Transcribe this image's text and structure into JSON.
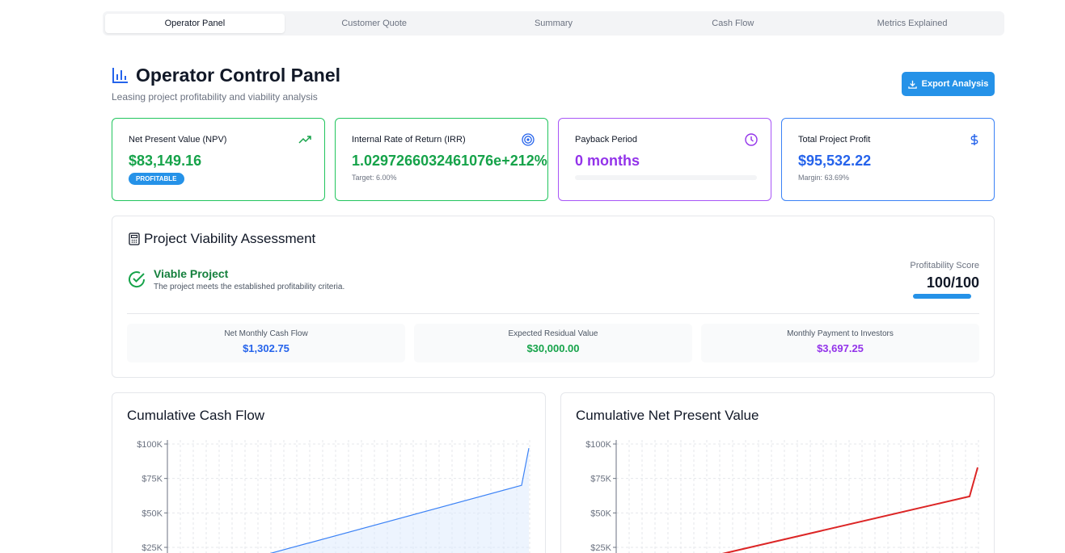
{
  "tabs": [
    "Operator Panel",
    "Customer Quote",
    "Summary",
    "Cash Flow",
    "Metrics Explained"
  ],
  "header": {
    "title": "Operator Control Panel",
    "subtitle": "Leasing project profitability and viability analysis",
    "export_label": "Export Analysis"
  },
  "kpis": {
    "npv": {
      "label": "Net Present Value (NPV)",
      "value": "$83,149.16",
      "badge": "PROFITABLE",
      "color": "#16a34a"
    },
    "irr": {
      "label": "Internal Rate of Return (IRR)",
      "value": "1.0297266032461076e+212%",
      "sub": "Target: 6.00%",
      "color": "#16a34a"
    },
    "payback": {
      "label": "Payback Period",
      "value": "0 months",
      "progress": 0,
      "color": "#9333ea"
    },
    "profit": {
      "label": "Total Project Profit",
      "value": "$95,532.22",
      "sub": "Margin: 63.69%",
      "color": "#2563eb"
    }
  },
  "viability": {
    "title": "Project Viability Assessment",
    "status_title": "Viable Project",
    "status_sub": "The project meets the established profitability criteria.",
    "score_label": "Profitability Score",
    "score_value": "100/100",
    "score": 100,
    "metrics": [
      {
        "label": "Net Monthly Cash Flow",
        "value": "$1,302.75",
        "color": "#2563eb"
      },
      {
        "label": "Expected Residual Value",
        "value": "$30,000.00",
        "color": "#16a34a"
      },
      {
        "label": "Monthly Payment to Investors",
        "value": "$3,697.25",
        "color": "#9333ea"
      }
    ]
  },
  "charts": {
    "cash_flow_title": "Cumulative Cash Flow",
    "npv_title": "Cumulative Net Present Value"
  },
  "chart_data": [
    {
      "type": "area",
      "title": "Cumulative Cash Flow",
      "ylim": [
        0,
        100000
      ],
      "yticks": [
        "$100K",
        "$75K",
        "$50K",
        "$25K"
      ],
      "grid": true,
      "color": "#3b82f6",
      "series": [
        {
          "x": [
            0,
            1,
            2
          ],
          "values": [
            15000,
            70000,
            97000
          ]
        }
      ]
    },
    {
      "type": "line",
      "title": "Cumulative Net Present Value",
      "ylim": [
        0,
        100000
      ],
      "yticks": [
        "$100K",
        "$75K",
        "$50K",
        "$25K"
      ],
      "grid": true,
      "color": "#dc2626",
      "series": [
        {
          "x": [
            0,
            1,
            2
          ],
          "values": [
            15000,
            62000,
            83000
          ]
        }
      ]
    }
  ]
}
